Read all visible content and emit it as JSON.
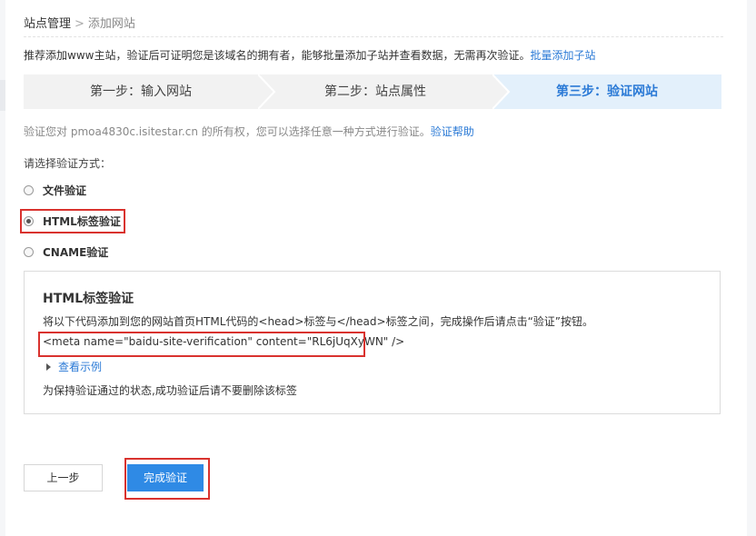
{
  "breadcrumb": {
    "root": "站点管理",
    "separator": ">",
    "current": "添加网站"
  },
  "intro": {
    "text": "推荐添加www主站，验证后可证明您是该域名的拥有者，能够批量添加子站并查看数据，无需再次验证。",
    "link": "批量添加子站"
  },
  "steps": [
    {
      "label": "第一步：输入网站",
      "active": false
    },
    {
      "label": "第二步：站点属性",
      "active": false
    },
    {
      "label": "第三步：验证网站",
      "active": true
    }
  ],
  "verify_desc": {
    "prefix": "验证您对 ",
    "domain": "pmoa4830c.isitestar.cn",
    "suffix": " 的所有权，您可以选择任意一种方式进行验证。",
    "help_link": "验证帮助"
  },
  "choose_label": "请选择验证方式：",
  "methods": [
    {
      "label": "文件验证",
      "checked": false
    },
    {
      "label": "HTML标签验证",
      "checked": true
    },
    {
      "label": "CNAME验证",
      "checked": false
    }
  ],
  "panel": {
    "title": "HTML标签验证",
    "instruction": "将以下代码添加到您的网站首页HTML代码的<head>标签与</head>标签之间，完成操作后请点击“验证”按钮。",
    "code": "<meta name=\"baidu-site-verification\" content=\"RL6jUqXyWN\" />",
    "example_link": "查看示例",
    "note": "为保持验证通过的状态,成功验证后请不要删除该标签"
  },
  "buttons": {
    "prev": "上一步",
    "done": "完成验证"
  },
  "colors": {
    "link": "#2b7ad6",
    "primary_button": "#2f8ae5",
    "highlight_box": "#d9322e",
    "active_step_bg": "#e3f0fb"
  }
}
